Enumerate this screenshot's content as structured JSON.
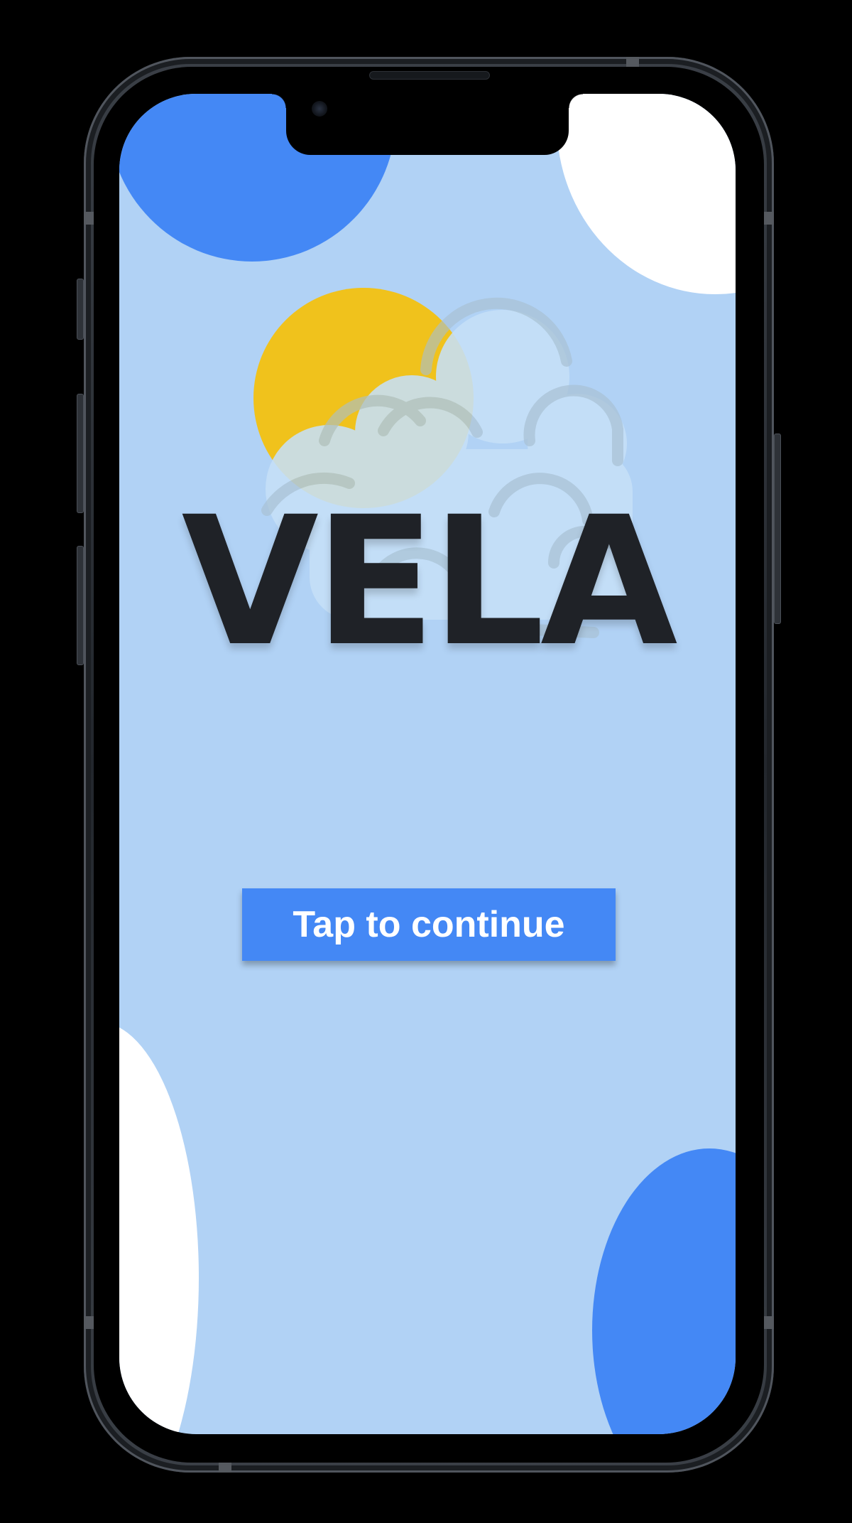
{
  "app": {
    "logo_text": "VELA"
  },
  "splash": {
    "cta_label": "Tap to continue"
  },
  "icons": {
    "weather_illustration": "sun-behind-cloud-icon",
    "camera": "front-camera-icon"
  },
  "colors": {
    "background": "#000000",
    "screen_background": "#b1d2f5",
    "accent_blue": "#4488f5",
    "sun_yellow": "#f0c21c",
    "cloud_fill": "#c6e0f8",
    "logo_text": "#1f2227",
    "button_text": "#ffffff",
    "white_blob": "#ffffff"
  }
}
